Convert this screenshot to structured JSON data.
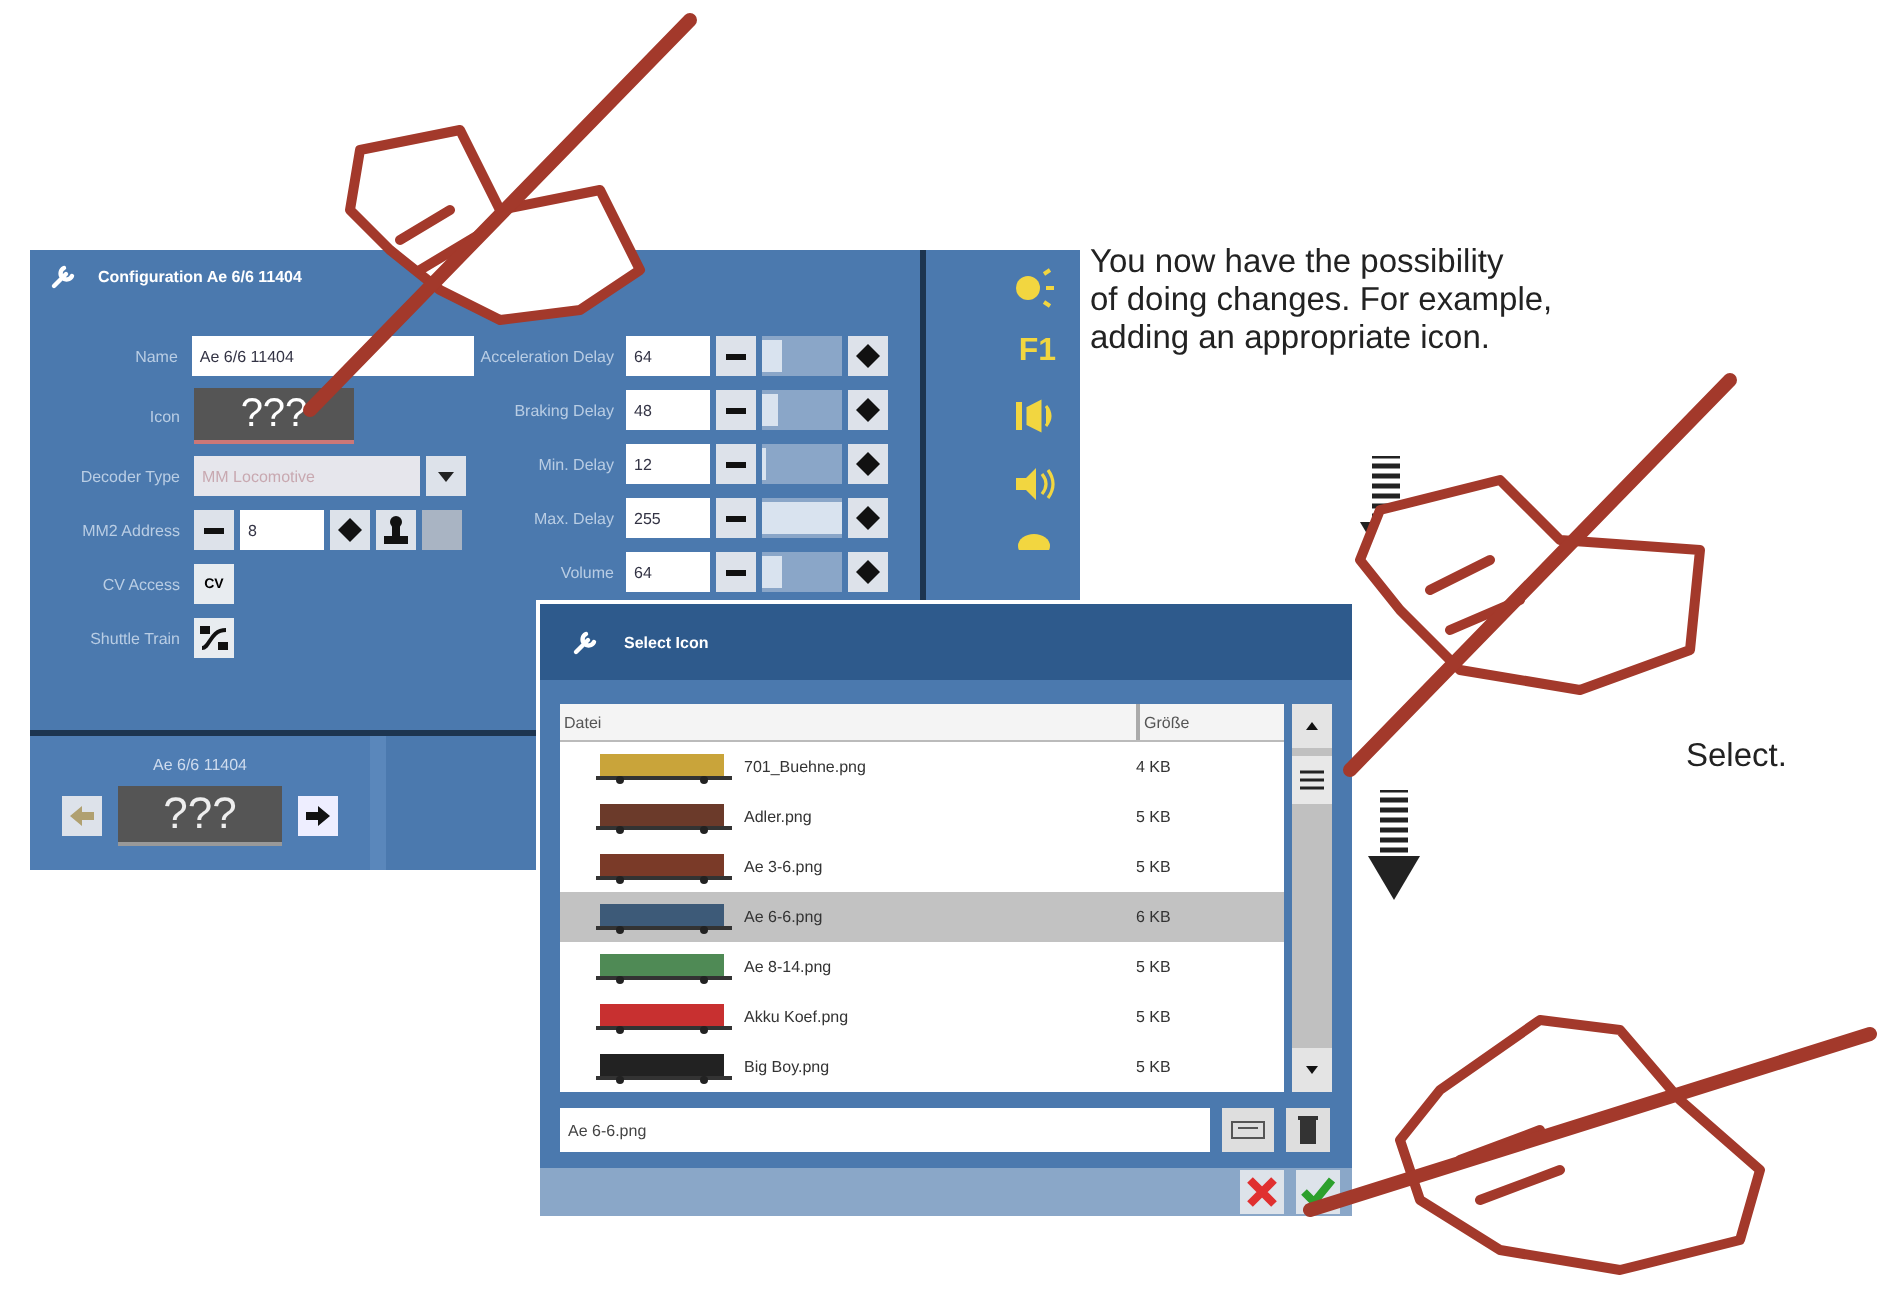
{
  "caption": {
    "lines": [
      "You now have the possibility",
      "of doing changes. For example,",
      "adding an appropriate icon."
    ]
  },
  "select_note": "Select.",
  "configuration": {
    "title": "Configuration Ae 6/6 11404",
    "fields": [
      {
        "kind": "text",
        "label": "Name",
        "value": "Ae 6/6 11404"
      },
      {
        "kind": "icon",
        "label": "Icon",
        "value": "???"
      },
      {
        "kind": "dropdown",
        "label": "Decoder Type",
        "value": "MM Locomotive",
        "disabled": true
      },
      {
        "kind": "stepper",
        "label": "MM2 Address",
        "value": "8"
      },
      {
        "kind": "cv",
        "label": "CV Access",
        "value": "CV"
      },
      {
        "kind": "shuttle",
        "label": "Shuttle Train"
      }
    ],
    "delays": [
      {
        "label": "Acceleration Delay",
        "value": "64",
        "level": 0.25
      },
      {
        "label": "Braking Delay",
        "value": "48",
        "level": 0.19
      },
      {
        "label": "Min. Delay",
        "value": "12",
        "level": 0.05
      },
      {
        "label": "Max. Delay",
        "value": "255",
        "level": 1.0
      },
      {
        "label": "Volume",
        "value": "64",
        "level": 0.25
      }
    ],
    "locomotive": {
      "name": "Ae 6/6 11404",
      "icon_text": "???"
    }
  },
  "function_icons": [
    {
      "kind": "light"
    },
    {
      "kind": "function",
      "label": "F1"
    },
    {
      "kind": "horn"
    },
    {
      "kind": "sound"
    },
    {
      "kind": "more"
    }
  ],
  "select_icon": {
    "title": "Select Icon",
    "columns": [
      "Datei",
      "Größe"
    ],
    "rows": [
      {
        "file": "701_Buehne.png",
        "size": "4 KB",
        "selected": false
      },
      {
        "file": "Adler.png",
        "size": "5 KB",
        "selected": false
      },
      {
        "file": "Ae 3-6.png",
        "size": "5 KB",
        "selected": false
      },
      {
        "file": "Ae 6-6.png",
        "size": "6 KB",
        "selected": true
      },
      {
        "file": "Ae 8-14.png",
        "size": "5 KB",
        "selected": false
      },
      {
        "file": "Akku Koef.png",
        "size": "5 KB",
        "selected": false
      },
      {
        "file": "Big Boy.png",
        "size": "5 KB",
        "selected": false
      }
    ],
    "filename": "Ae 6-6.png"
  }
}
